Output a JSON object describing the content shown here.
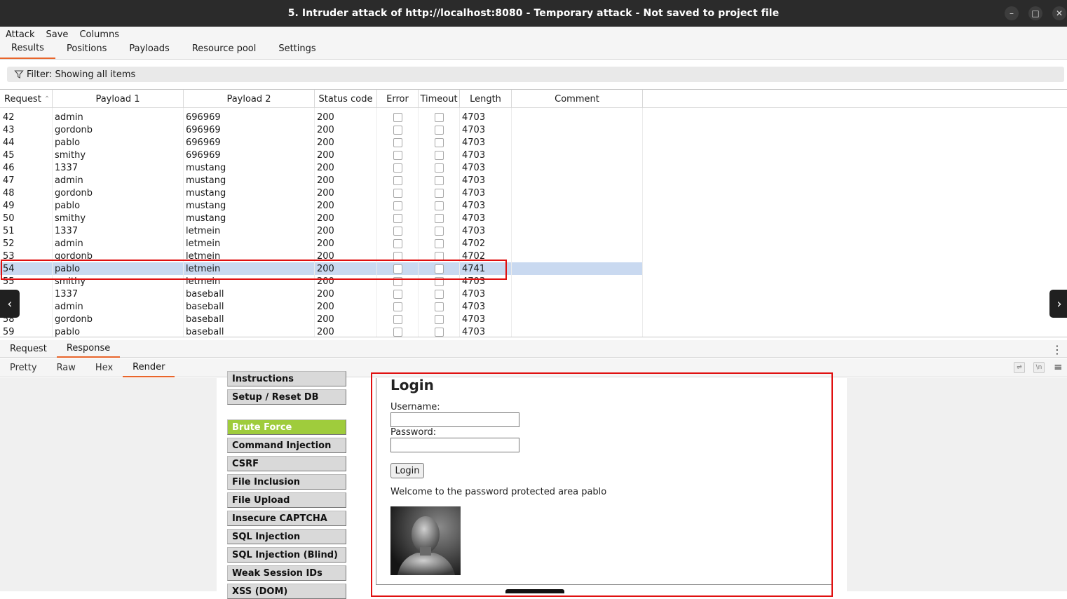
{
  "window": {
    "title": "5. Intruder attack of http://localhost:8080 - Temporary attack - Not saved to project file",
    "controls": {
      "minimize": "–",
      "maximize": "□",
      "close": "✕"
    }
  },
  "menubar": {
    "items": [
      "Attack",
      "Save",
      "Columns"
    ]
  },
  "main_tabs": {
    "items": [
      "Results",
      "Positions",
      "Payloads",
      "Resource pool",
      "Settings"
    ],
    "active": "Results"
  },
  "filter": {
    "text": "Filter: Showing all items",
    "icon": "filter-icon"
  },
  "table": {
    "headers": {
      "request": "Request",
      "payload1": "Payload 1",
      "payload2": "Payload 2",
      "status": "Status code",
      "error": "Error",
      "timeout": "Timeout",
      "length": "Length",
      "comment": "Comment"
    },
    "sort_indicator": "^",
    "rows": [
      {
        "request": "42",
        "payload1": "admin",
        "payload2": "696969",
        "status": "200",
        "length": "4703"
      },
      {
        "request": "43",
        "payload1": "gordonb",
        "payload2": "696969",
        "status": "200",
        "length": "4703"
      },
      {
        "request": "44",
        "payload1": "pablo",
        "payload2": "696969",
        "status": "200",
        "length": "4703"
      },
      {
        "request": "45",
        "payload1": "smithy",
        "payload2": "696969",
        "status": "200",
        "length": "4703"
      },
      {
        "request": "46",
        "payload1": "1337",
        "payload2": "mustang",
        "status": "200",
        "length": "4703"
      },
      {
        "request": "47",
        "payload1": "admin",
        "payload2": "mustang",
        "status": "200",
        "length": "4703"
      },
      {
        "request": "48",
        "payload1": "gordonb",
        "payload2": "mustang",
        "status": "200",
        "length": "4703"
      },
      {
        "request": "49",
        "payload1": "pablo",
        "payload2": "mustang",
        "status": "200",
        "length": "4703"
      },
      {
        "request": "50",
        "payload1": "smithy",
        "payload2": "mustang",
        "status": "200",
        "length": "4703"
      },
      {
        "request": "51",
        "payload1": "1337",
        "payload2": "letmein",
        "status": "200",
        "length": "4703"
      },
      {
        "request": "52",
        "payload1": "admin",
        "payload2": "letmein",
        "status": "200",
        "length": "4702"
      },
      {
        "request": "53",
        "payload1": "gordonb",
        "payload2": "letmein",
        "status": "200",
        "length": "4702"
      },
      {
        "request": "54",
        "payload1": "pablo",
        "payload2": "letmein",
        "status": "200",
        "length": "4741",
        "selected": true
      },
      {
        "request": "55",
        "payload1": "smithy",
        "payload2": "letmein",
        "status": "200",
        "length": "4703"
      },
      {
        "request": "",
        "payload1": "1337",
        "payload2": "baseball",
        "status": "200",
        "length": "4703"
      },
      {
        "request": "",
        "payload1": "admin",
        "payload2": "baseball",
        "status": "200",
        "length": "4703"
      },
      {
        "request": "58",
        "payload1": "gordonb",
        "payload2": "baseball",
        "status": "200",
        "length": "4703"
      },
      {
        "request": "59",
        "payload1": "pablo",
        "payload2": "baseball",
        "status": "200",
        "length": "4703"
      }
    ]
  },
  "nav_arrows": {
    "left": "‹",
    "right": "›"
  },
  "rr_tabs": {
    "items": [
      "Request",
      "Response"
    ],
    "active": "Response",
    "more": "⋮"
  },
  "view_tabs": {
    "items": [
      "Pretty",
      "Raw",
      "Hex",
      "Render"
    ],
    "active": "Render",
    "wrap_label": "⇌",
    "newline_label": "\\n",
    "menu": "≡"
  },
  "render": {
    "nav_items": [
      {
        "label": "Instructions",
        "active": false
      },
      {
        "label": "Setup / Reset DB",
        "active": false
      },
      {
        "label": "Brute Force",
        "active": true
      },
      {
        "label": "Command Injection",
        "active": false
      },
      {
        "label": "CSRF",
        "active": false
      },
      {
        "label": "File Inclusion",
        "active": false
      },
      {
        "label": "File Upload",
        "active": false
      },
      {
        "label": "Insecure CAPTCHA",
        "active": false
      },
      {
        "label": "SQL Injection",
        "active": false
      },
      {
        "label": "SQL Injection (Blind)",
        "active": false
      },
      {
        "label": "Weak Session IDs",
        "active": false
      },
      {
        "label": "XSS (DOM)",
        "active": false
      }
    ],
    "login_title": "Login",
    "username_label": "Username:",
    "password_label": "Password:",
    "login_button": "Login",
    "welcome": "Welcome to the password protected area pablo"
  },
  "colors": {
    "accent": "#e8652b",
    "selected_row": "#c9d9f0",
    "highlight": "#e01010",
    "dvwa_active": "#9fcc3c"
  }
}
